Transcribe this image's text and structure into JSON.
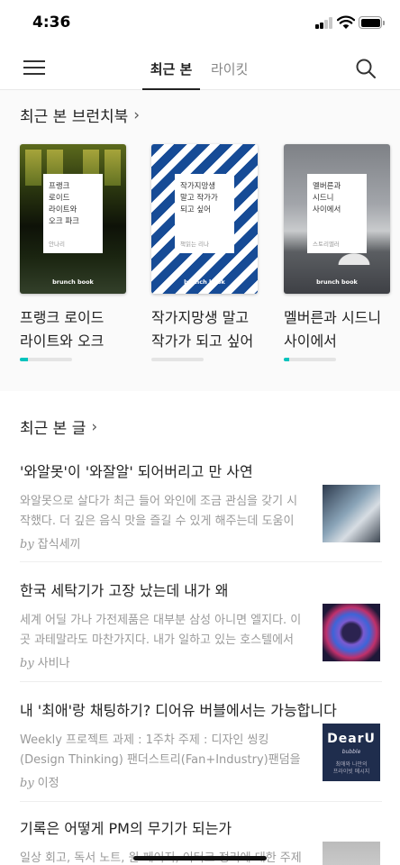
{
  "status_bar": {
    "time": "4:36"
  },
  "nav": {
    "tabs": [
      {
        "label": "최근 본",
        "active": true
      },
      {
        "label": "라이킷",
        "active": false
      }
    ]
  },
  "recent_books": {
    "title": "최근 본 브런치북",
    "chevron": "›",
    "books": [
      {
        "cover_title": "프랭크\n로이드\n라이트와\n오크 파크",
        "cover_author": "안나리",
        "brand": "brunch book",
        "title_line1": "프랭크 로이드",
        "title_line2": "라이트와 오크",
        "progress": 0.15
      },
      {
        "cover_title": "작가지망생\n말고 작가가\n되고 싶어",
        "cover_author": "책읽는 리나",
        "brand": "brunch book",
        "title_line1": "작가지망생 말고",
        "title_line2": "작가가 되고 싶어",
        "progress": 0.0
      },
      {
        "cover_title": "멜버른과\n시드니\n사이에서",
        "cover_author": "스토리멜러",
        "brand": "brunch book",
        "title_line1": "멜버른과 시드니",
        "title_line2": "사이에서",
        "progress": 0.1
      }
    ]
  },
  "recent_articles": {
    "title": "최근 본 글",
    "chevron": "›",
    "by_label": "by",
    "items": [
      {
        "title": "'와알못'이  '와잘알' 되어버리고 만 사연",
        "summary": "와알못으로 살다가 최근 들어 와인에 조금 관심을 갖기 시작했다. 더 깊은 음식 맛을 즐길 수 있게 해주는데 도움이",
        "author": "잡식세끼"
      },
      {
        "title": "한국 세탁기가 고장 났는데 내가 왜",
        "summary": "세계 어딜 가나 가전제품은 대부분 삼성 아니면 엘지다. 이곳 과테말라도 마찬가지다. 내가 일하고 있는 호스텔에서",
        "author": "사비나"
      },
      {
        "title": "내 '최애'랑 채팅하기? 디어유 버블에서는 가능합니다",
        "summary": "Weekly 프로젝트 과제 : 1주차 주제 : 디자인 씽킹 (Design Thinking) 팬더스트리(Fan+Industry)팬덤을 기반으로 한",
        "author": "이정",
        "thumb_title": "DearU",
        "thumb_sub": "bubble",
        "thumb_caption": "최애와 나만의\n프라이빗 메시지"
      },
      {
        "title": "기록은 어떻게 PM의 무기가 되는가",
        "summary": "일상 회고, 독서 노트, 원 페이지, 이터크 정리에 대한 주제로",
        "author": ""
      }
    ]
  }
}
